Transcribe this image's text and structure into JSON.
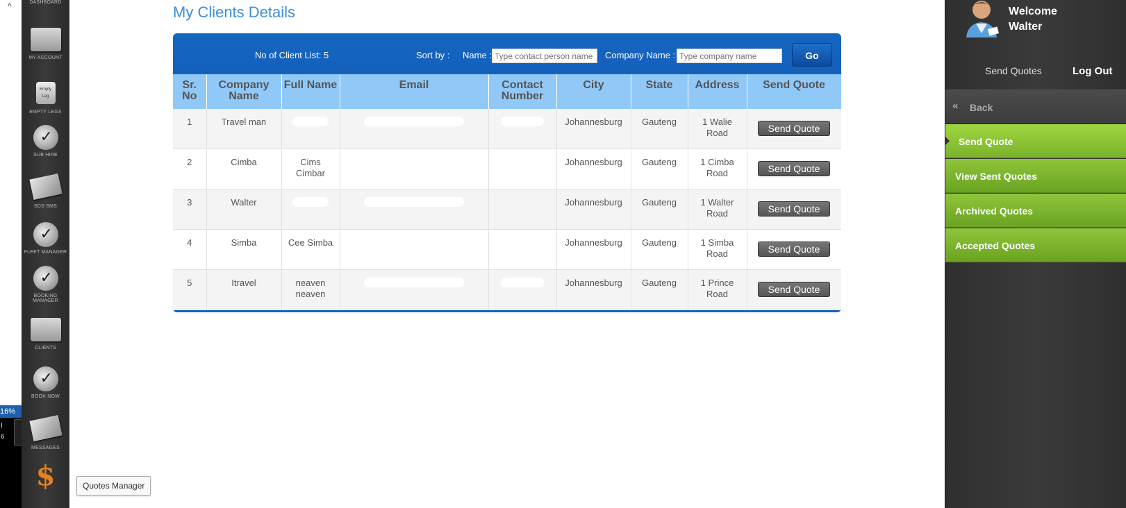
{
  "edge": {
    "percent": "16%",
    "line1": "I",
    "line2": "6"
  },
  "dock": {
    "items": [
      {
        "label": "Dashboard"
      },
      {
        "label": "My Account"
      },
      {
        "label": "Empty Legs",
        "icon_text": "Empty Leg"
      },
      {
        "label": "Sub Hire"
      },
      {
        "label": "SDS SMS"
      },
      {
        "label": "Fleet Manager"
      },
      {
        "label": "Booking Manager"
      },
      {
        "label": "Clients"
      },
      {
        "label": "Book Now"
      },
      {
        "label": "Messages"
      }
    ],
    "tooltip": "Quotes Manager"
  },
  "main": {
    "title": "My Clients Details",
    "toolbar": {
      "count": "No of Client List: 5",
      "sort_by": "Sort by :",
      "name_label": "Name :",
      "name_placeholder": "Type contact person name",
      "company_label": "Company Name :",
      "company_placeholder": "Type company name",
      "go_label": "Go"
    },
    "columns": [
      "Sr. No",
      "Company Name",
      "Full Name",
      "Email",
      "Contact Number",
      "City",
      "State",
      "Address",
      "Send Quote"
    ],
    "rows": [
      {
        "sr": "1",
        "company": "Travel man",
        "full_name": "",
        "city": "Johannesburg",
        "state": "Gauteng",
        "address": "1 Walie Road",
        "button": "Send Quote"
      },
      {
        "sr": "2",
        "company": "Cimba",
        "full_name": "Cims Cimbar",
        "city": "Johannesburg",
        "state": "Gauteng",
        "address": "1 Cimba Road",
        "button": "Send Quote"
      },
      {
        "sr": "3",
        "company": "Walter",
        "full_name": "",
        "city": "Johannesburg",
        "state": "Gauteng",
        "address": "1 Walter Road",
        "button": "Send Quote"
      },
      {
        "sr": "4",
        "company": "Simba",
        "full_name": "Cee Simba",
        "city": "Johannesburg",
        "state": "Gauteng",
        "address": "1 Simba Road",
        "button": "Send Quote"
      },
      {
        "sr": "5",
        "company": "Itravel",
        "full_name": "neaven neaven",
        "city": "Johannesburg",
        "state": "Gauteng",
        "address": "1 Prince Road",
        "button": "Send Quote"
      }
    ]
  },
  "right": {
    "welcome": "Welcome",
    "user": "Walter",
    "send_quotes": "Send Quotes",
    "logout": "Log Out",
    "back": "Back",
    "menu": [
      "Send Quote",
      "View Sent Quotes",
      "Archived Quotes",
      "Accepted Quotes"
    ]
  }
}
